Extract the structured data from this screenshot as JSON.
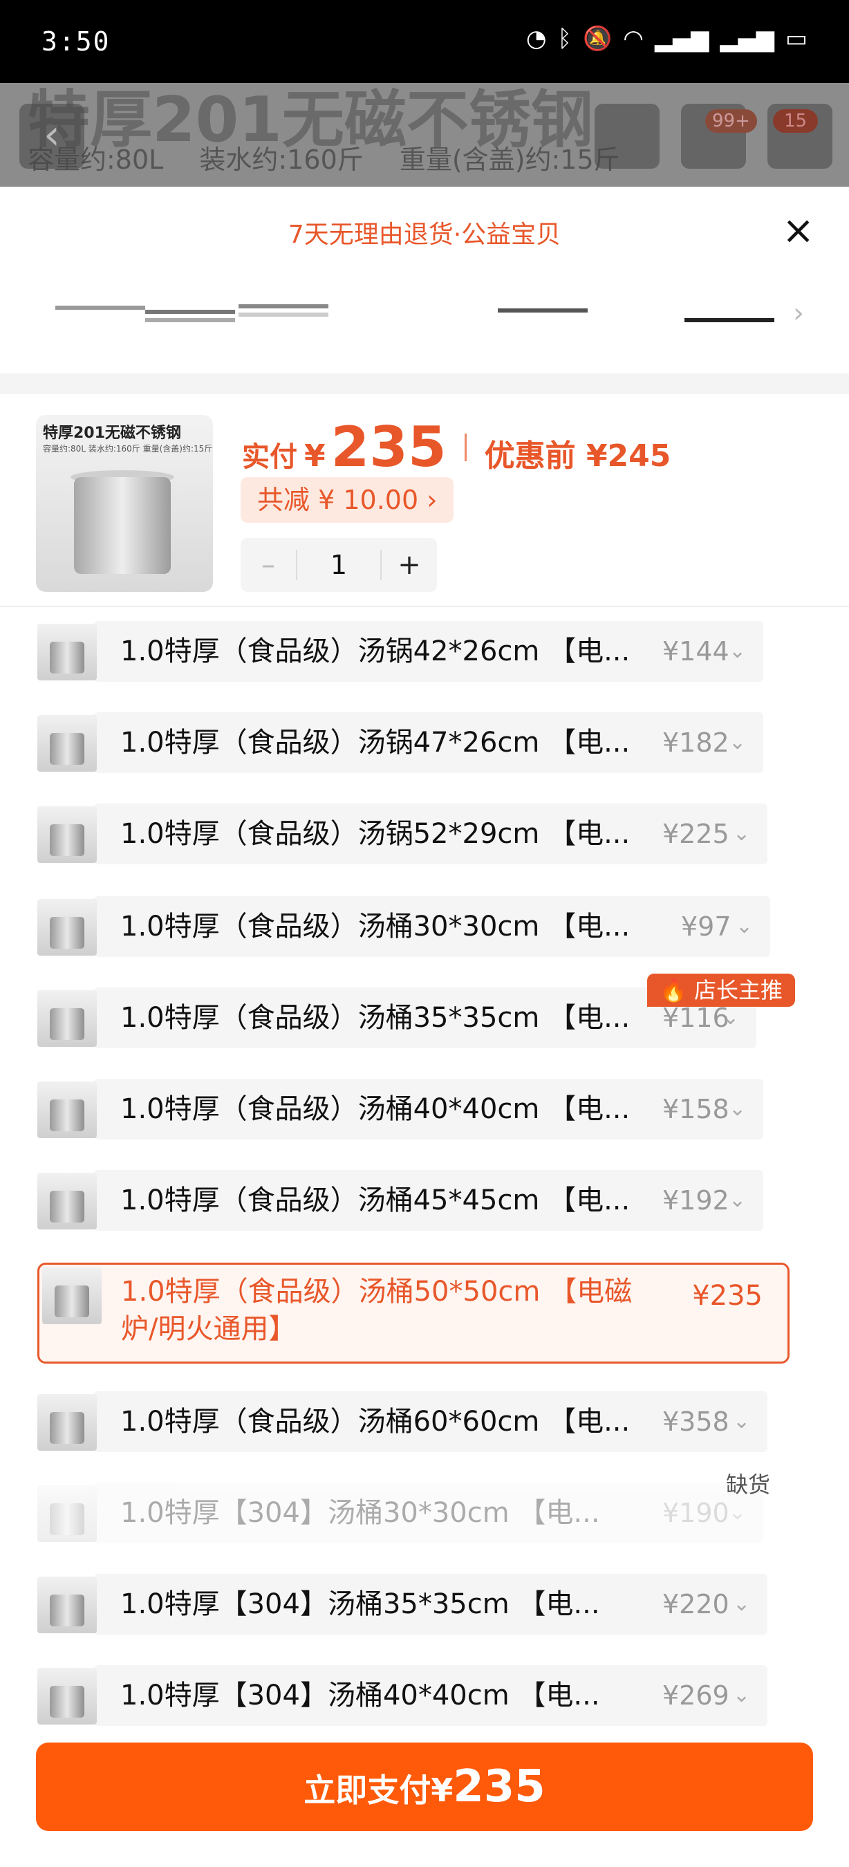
{
  "status": {
    "time": "3:50"
  },
  "background": {
    "title": "特厚201无磁不锈钢",
    "subtitle": "容量约:80L 装水约:160斤 重量(含盖)约:15斤",
    "badge_cart": "99+",
    "badge_more": "15"
  },
  "sheet": {
    "promo": "7天无理由退货·公益宝贝",
    "close_icon": "×"
  },
  "product": {
    "image_title": "特厚201无磁不锈钢",
    "image_sub": "容量约:80L 装水约:160斤 重量(含盖)约:15斤",
    "paid_label": "实付",
    "yen": "¥",
    "paid_value": "235",
    "before_label": "优惠前 ¥245",
    "discount_label": "共减 ¥ 10.00 ›",
    "quantity": "1",
    "minus": "–",
    "plus": "+"
  },
  "options": [
    {
      "text": "1.0特厚（食品级）汤锅42*26cm 【电...",
      "price": "¥144"
    },
    {
      "text": "1.0特厚（食品级）汤锅47*26cm 【电...",
      "price": "¥182"
    },
    {
      "text": "1.0特厚（食品级）汤锅52*29cm 【电...",
      "price": "¥225"
    },
    {
      "text": "1.0特厚（食品级）汤桶30*30cm 【电...",
      "price": "¥97"
    },
    {
      "text": "1.0特厚（食品级）汤桶35*35cm 【电...",
      "price": "¥116"
    },
    {
      "text": "1.0特厚（食品级）汤桶40*40cm 【电...",
      "price": "¥158"
    },
    {
      "text": "1.0特厚（食品级）汤桶45*45cm 【电...",
      "price": "¥192"
    },
    {
      "text": "1.0特厚（食品级）汤桶50*50cm 【电磁炉/明火通用】",
      "price": "¥235"
    },
    {
      "text": "1.0特厚（食品级）汤桶60*60cm 【电...",
      "price": "¥358"
    },
    {
      "text": "1.0特厚【304】汤桶30*30cm 【电...",
      "price": "¥190"
    },
    {
      "text": "1.0特厚【304】汤桶35*35cm 【电...",
      "price": "¥220"
    },
    {
      "text": "1.0特厚【304】汤桶40*40cm 【电...",
      "price": "¥269"
    }
  ],
  "badges": {
    "hot": "店长主推",
    "out_of_stock": "缺货"
  },
  "pay": {
    "label": "立即支付¥",
    "value": "235"
  },
  "colors": {
    "accent": "#e8572a",
    "pay_button": "#ff5a0a"
  }
}
